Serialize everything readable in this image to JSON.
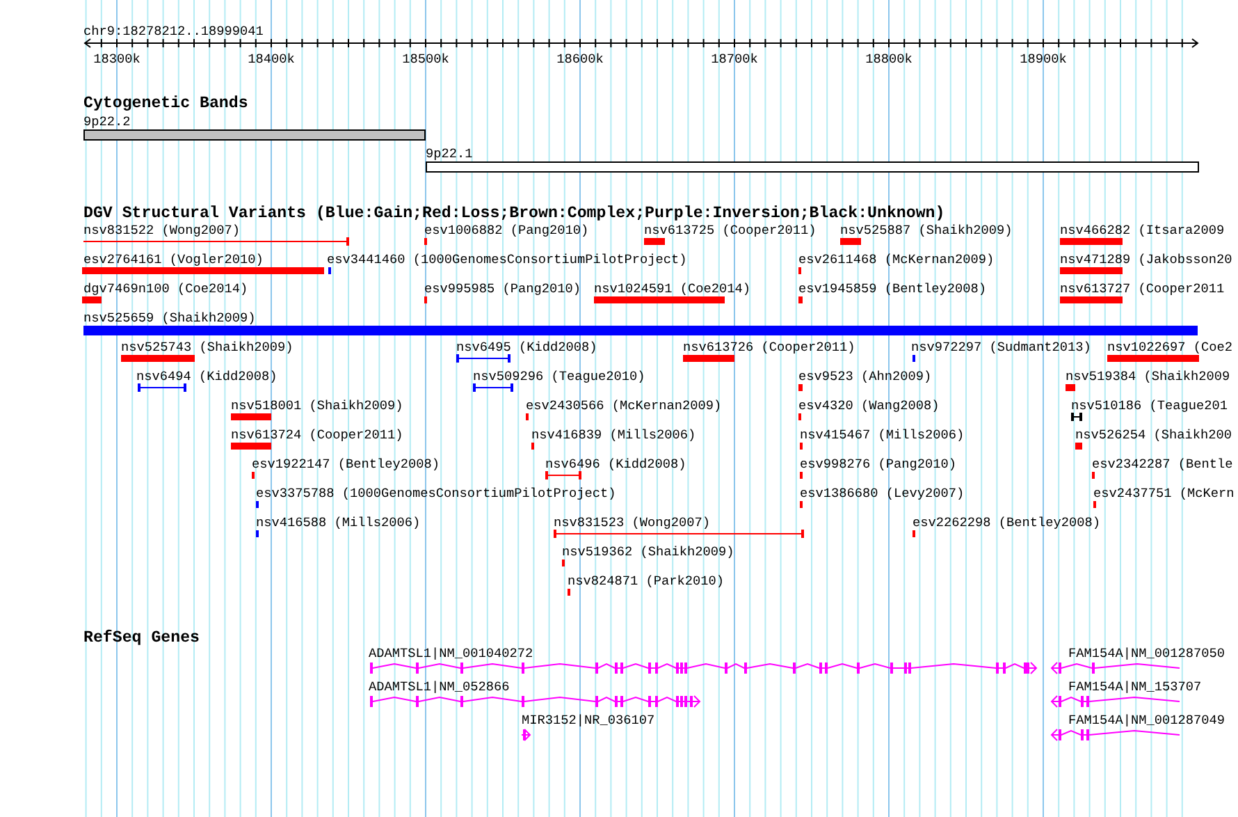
{
  "ruler": {
    "location": "chr9:18278212..18999041",
    "ticks": [
      "18300k",
      "18400k",
      "18500k",
      "18600k",
      "18700k",
      "18800k",
      "18900k"
    ]
  },
  "bands": {
    "title": "Cytogenetic Bands",
    "features": [
      {
        "label": "9p22.2",
        "color": "#c0c0c0"
      },
      {
        "label": "9p22.1",
        "color": "#ffffff"
      }
    ]
  },
  "variants": {
    "title": "DGV Structural Variants (Blue:Gain;Red:Loss;Brown:Complex;Purple:Inversion;Black:Unknown)",
    "features": [
      {
        "label": "nsv831522 (Wong2007)",
        "color": "#ff0000",
        "kind": "span"
      },
      {
        "label": "esv1006882 (Pang2010)",
        "color": "#ff0000",
        "kind": "block"
      },
      {
        "label": "nsv613725 (Cooper2011)",
        "color": "#ff0000",
        "kind": "block"
      },
      {
        "label": "nsv525887 (Shaikh2009)",
        "color": "#ff0000",
        "kind": "block"
      },
      {
        "label": "nsv466282 (Itsara2009",
        "color": "#ff0000",
        "kind": "block"
      },
      {
        "label": "esv2764161 (Vogler2010)",
        "color": "#ff0000",
        "kind": "block"
      },
      {
        "label": "esv3441460 (1000GenomesConsortiumPilotProject)",
        "color": "#0000ff",
        "kind": "block"
      },
      {
        "label": "esv2611468 (McKernan2009)",
        "color": "#ff0000",
        "kind": "block"
      },
      {
        "label": "nsv471289 (Jakobsson20",
        "color": "#ff0000",
        "kind": "block"
      },
      {
        "label": "dgv7469n100 (Coe2014)",
        "color": "#ff0000",
        "kind": "block"
      },
      {
        "label": "esv995985 (Pang2010)",
        "color": "#ff0000",
        "kind": "block"
      },
      {
        "label": "nsv1024591 (Coe2014)",
        "color": "#ff0000",
        "kind": "block"
      },
      {
        "label": "esv1945859 (Bentley2008)",
        "color": "#ff0000",
        "kind": "block"
      },
      {
        "label": "nsv613727 (Cooper2011",
        "color": "#ff0000",
        "kind": "block"
      },
      {
        "label": "nsv525659 (Shaikh2009)",
        "color": "#0000ff",
        "kind": "block"
      },
      {
        "label": "nsv525743 (Shaikh2009)",
        "color": "#ff0000",
        "kind": "block"
      },
      {
        "label": "nsv6495 (Kidd2008)",
        "color": "#0000ff",
        "kind": "span"
      },
      {
        "label": "nsv613726 (Cooper2011)",
        "color": "#ff0000",
        "kind": "block"
      },
      {
        "label": "nsv972297 (Sudmant2013)",
        "color": "#0000ff",
        "kind": "block"
      },
      {
        "label": "nsv1022697 (Coe2",
        "color": "#ff0000",
        "kind": "block"
      },
      {
        "label": "nsv6494 (Kidd2008)",
        "color": "#0000ff",
        "kind": "span"
      },
      {
        "label": "nsv509296 (Teague2010)",
        "color": "#0000ff",
        "kind": "span"
      },
      {
        "label": "esv9523 (Ahn2009)",
        "color": "#ff0000",
        "kind": "block"
      },
      {
        "label": "nsv519384 (Shaikh2009",
        "color": "#ff0000",
        "kind": "block"
      },
      {
        "label": "nsv518001 (Shaikh2009)",
        "color": "#ff0000",
        "kind": "block"
      },
      {
        "label": "esv2430566 (McKernan2009)",
        "color": "#ff0000",
        "kind": "block"
      },
      {
        "label": "esv4320 (Wang2008)",
        "color": "#ff0000",
        "kind": "block"
      },
      {
        "label": "nsv510186 (Teague201",
        "color": "#000000",
        "kind": "span"
      },
      {
        "label": "nsv613724 (Cooper2011)",
        "color": "#ff0000",
        "kind": "block"
      },
      {
        "label": "nsv416839 (Mills2006)",
        "color": "#ff0000",
        "kind": "block"
      },
      {
        "label": "nsv415467 (Mills2006)",
        "color": "#ff0000",
        "kind": "block"
      },
      {
        "label": "nsv526254 (Shaikh200",
        "color": "#ff0000",
        "kind": "block"
      },
      {
        "label": "esv1922147 (Bentley2008)",
        "color": "#ff0000",
        "kind": "block"
      },
      {
        "label": "nsv6496 (Kidd2008)",
        "color": "#ff0000",
        "kind": "span"
      },
      {
        "label": "esv998276 (Pang2010)",
        "color": "#ff0000",
        "kind": "block"
      },
      {
        "label": "esv2342287 (Bentle",
        "color": "#ff0000",
        "kind": "block"
      },
      {
        "label": "esv3375788 (1000GenomesConsortiumPilotProject)",
        "color": "#0000ff",
        "kind": "block"
      },
      {
        "label": "esv1386680 (Levy2007)",
        "color": "#ff0000",
        "kind": "block"
      },
      {
        "label": "esv2437751 (McKern",
        "color": "#ff0000",
        "kind": "block"
      },
      {
        "label": "nsv416588 (Mills2006)",
        "color": "#0000ff",
        "kind": "block"
      },
      {
        "label": "nsv831523 (Wong2007)",
        "color": "#ff0000",
        "kind": "span"
      },
      {
        "label": "esv2262298 (Bentley2008)",
        "color": "#ff0000",
        "kind": "block"
      },
      {
        "label": "nsv519362 (Shaikh2009)",
        "color": "#ff0000",
        "kind": "block"
      },
      {
        "label": "nsv824871 (Park2010)",
        "color": "#ff0000",
        "kind": "block"
      }
    ]
  },
  "genes": {
    "title": "RefSeq Genes",
    "features": [
      {
        "label": "ADAMTSL1|NM_001040272"
      },
      {
        "label": "ADAMTSL1|NM_052866"
      },
      {
        "label": "MIR3152|NR_036107"
      },
      {
        "label": "FAM154A|NM_001287050"
      },
      {
        "label": "FAM154A|NM_153707"
      },
      {
        "label": "FAM154A|NM_001287049"
      }
    ]
  }
}
